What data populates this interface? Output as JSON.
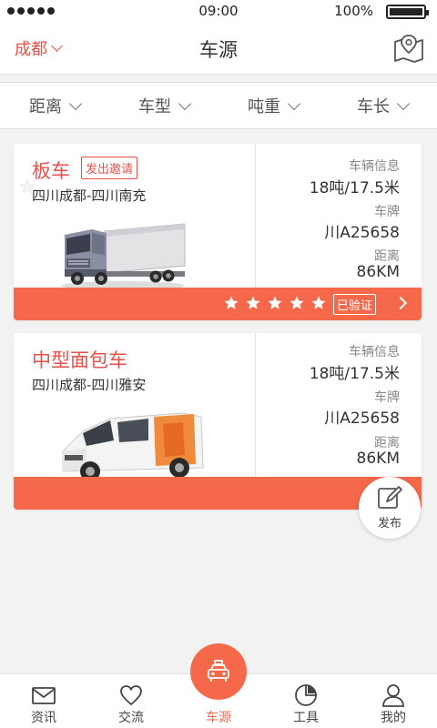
{
  "status_bar": {
    "time": "09:00",
    "battery": "100%"
  },
  "header": {
    "city": "成都",
    "title": "车源",
    "map_icon": "map-pin-icon"
  },
  "filters": [
    {
      "label": "距离"
    },
    {
      "label": "车型"
    },
    {
      "label": "吨重"
    },
    {
      "label": "车长"
    }
  ],
  "listings": [
    {
      "vehicle_type": "板车",
      "invite_label": "发出邀请",
      "route": "四川成都-四川南充",
      "info_label": "车辆信息",
      "info_value": "18吨/17.5米",
      "plate_label": "车牌",
      "plate_value": "川A25658",
      "distance_label": "距离",
      "distance_value": "86KM",
      "rating": 5,
      "verified_label": "已验证"
    },
    {
      "vehicle_type": "中型面包车",
      "route": "四川成都-四川雅安",
      "info_label": "车辆信息",
      "info_value": "18吨/17.5米",
      "plate_label": "车牌",
      "plate_value": "川A25658",
      "distance_label": "距离",
      "distance_value": "86KM"
    }
  ],
  "fab": {
    "label": "发布",
    "icon": "pencil-icon"
  },
  "tabs": [
    {
      "label": "资讯",
      "icon": "envelope-icon"
    },
    {
      "label": "交流",
      "icon": "heart-icon"
    },
    {
      "label": "车源",
      "icon": "taxi-icon",
      "active": true
    },
    {
      "label": "工具",
      "icon": "pie-chart-icon"
    },
    {
      "label": "我的",
      "icon": "user-icon"
    }
  ],
  "colors": {
    "accent": "#f5694a",
    "brand_red": "#e8504a"
  }
}
